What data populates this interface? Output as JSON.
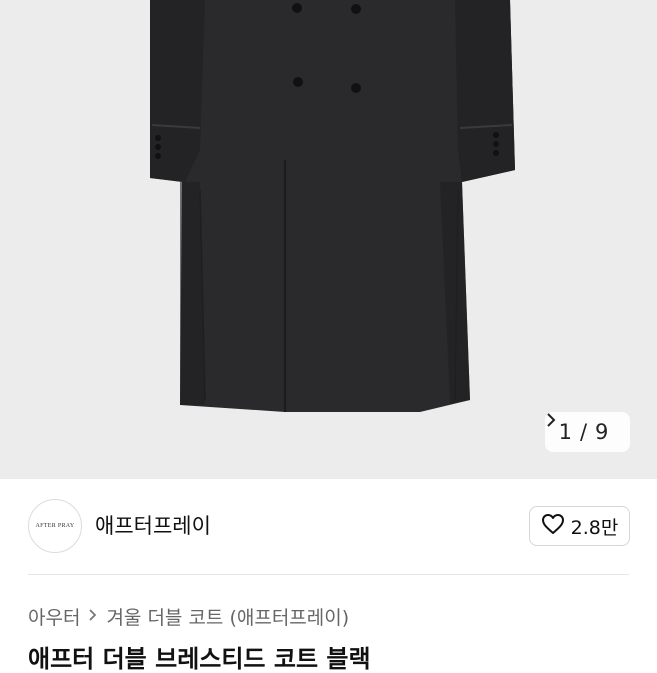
{
  "hero": {
    "image_alt": "double coat product photo",
    "counter_current": "1",
    "counter_sep": "/",
    "counter_total": "9",
    "counter_next_icon": "chevron-right-icon"
  },
  "seller": {
    "avatar_text": "AFTER PRAY",
    "name": "애프터프레이",
    "like_icon": "heart-outline-icon",
    "like_count": "2.8만"
  },
  "breadcrumb": {
    "items": [
      "아우터",
      "겨울 더블 코트 (애프터프레이)"
    ],
    "separator_icon": "chevron-right-icon"
  },
  "product": {
    "title": "애프터 더블 브레스티드 코트 블랙"
  }
}
